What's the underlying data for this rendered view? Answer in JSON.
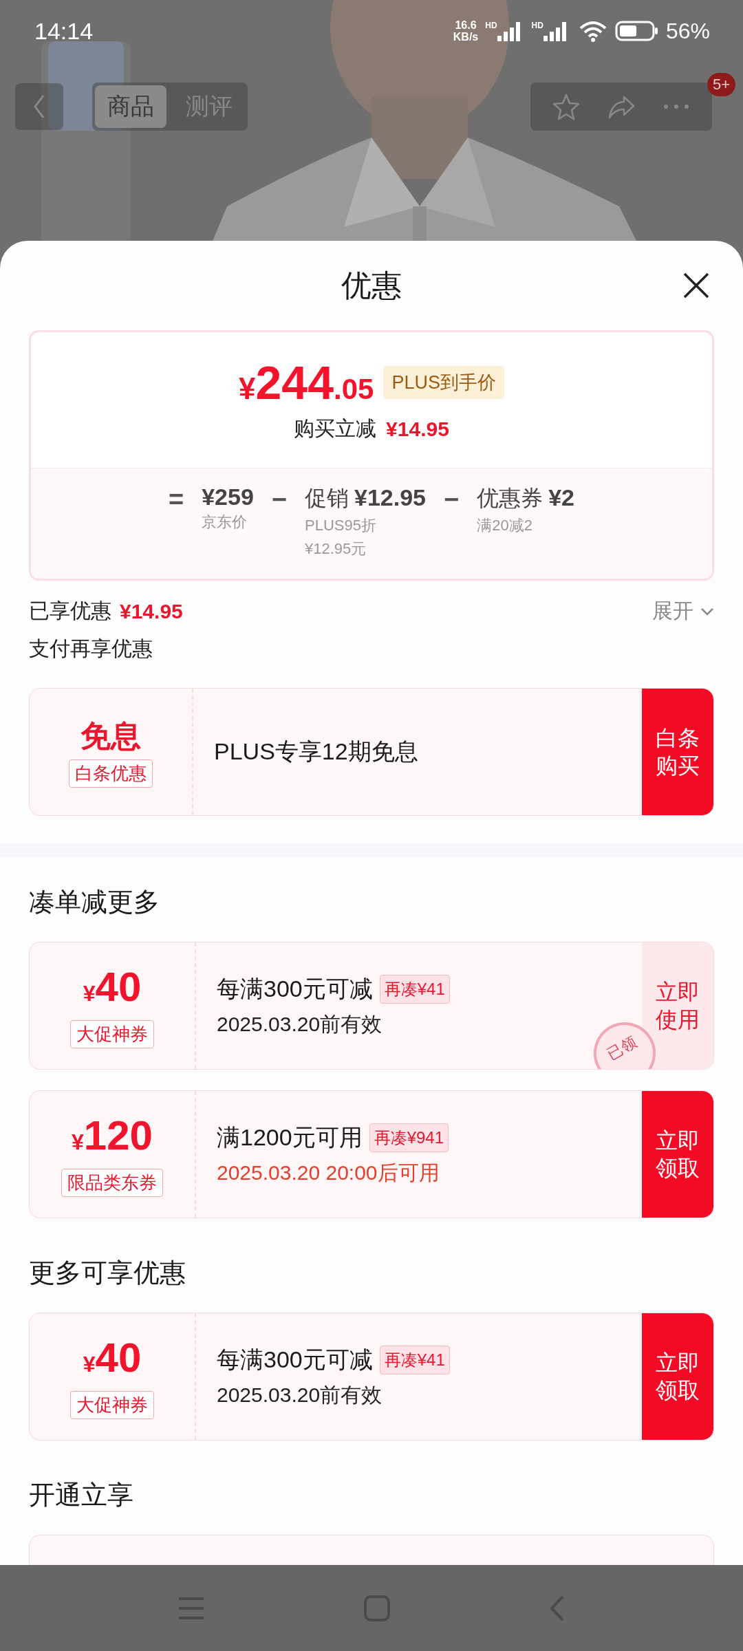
{
  "status_bar": {
    "time": "14:14",
    "speed": [
      "16.6",
      "KB/s"
    ],
    "network_labels": [
      "HD",
      "HD"
    ],
    "battery": "56%"
  },
  "nav": {
    "tabs": [
      {
        "label": "商品",
        "selected": true
      },
      {
        "label": "测评",
        "selected": false
      }
    ],
    "badge": "5+"
  },
  "sheet": {
    "title": "优惠",
    "price_card": {
      "currency": "¥",
      "integer": "244",
      "decimal": ".05",
      "badge": "PLUS到手价",
      "cut_label": "购买立减",
      "cut_amount": "¥14.95",
      "breakdown": [
        {
          "op": "=",
          "amount": "¥259",
          "notes": [
            "京东价"
          ]
        },
        {
          "op": "−",
          "name": "促销",
          "amount": "¥12.95",
          "notes": [
            "PLUS95折",
            "¥12.95元"
          ]
        },
        {
          "op": "−",
          "name": "优惠券",
          "amount": "¥2",
          "notes": [
            "满20减2"
          ]
        }
      ]
    },
    "enjoyed": {
      "label": "已享优惠",
      "amount": "¥14.95",
      "toggle": "展开"
    },
    "pay_title": "支付再享优惠",
    "pay_offer": {
      "headline": "免息",
      "tag": "白条优惠",
      "title": "PLUS专享12期免息",
      "button": "白条购买"
    },
    "sections": [
      {
        "title": "凑单减更多",
        "coupons": [
          {
            "currency": "¥",
            "amount": "40",
            "tag": "大促神券",
            "title": "每满300元可减",
            "extra": "再凑¥41",
            "validity": "2025.03.20前有效",
            "starts_later": false,
            "claimed": true,
            "stamp": "已领",
            "button": "立即使用"
          },
          {
            "currency": "¥",
            "amount": "120",
            "tag": "限品类东券",
            "title": "满1200元可用",
            "extra": "再凑¥941",
            "validity": "2025.03.20 20:00后可用",
            "starts_later": true,
            "claimed": false,
            "button": "立即领取"
          }
        ]
      },
      {
        "title": "更多可享优惠",
        "coupons": [
          {
            "currency": "¥",
            "amount": "40",
            "tag": "大促神券",
            "title": "每满300元可减",
            "extra": "再凑¥41",
            "validity": "2025.03.20前有效",
            "starts_later": false,
            "claimed": false,
            "button": "立即领取"
          }
        ]
      },
      {
        "title": "开通立享"
      }
    ]
  }
}
